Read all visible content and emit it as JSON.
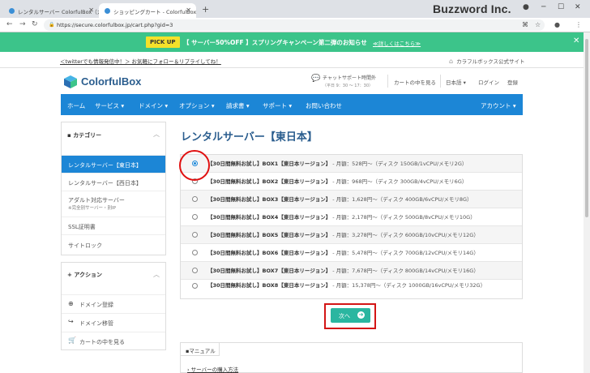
{
  "browser": {
    "tabs": [
      {
        "label": "レンタルサーバー ColorfulBox（カラフ"
      },
      {
        "label": "ショッピングカート - ColorfulBox"
      }
    ],
    "url": "https://secure.colorfulbox.jp/cart.php?gid=3",
    "brand": "Buzzword Inc."
  },
  "banner": {
    "pickup": "PICK UP",
    "text": "【 サーバー50%OFF 】スプリングキャンペーン第二弾のお知らせ",
    "link": "≪詳しくはこちら≫"
  },
  "infobar": {
    "twitter": "＜twitterでも情報発信中！＞ お気軽にフォロー＆リプライしてね！",
    "official": "カラフルボックス公式サイト"
  },
  "header": {
    "logo": "ColorfulBox",
    "chat_line1": "チャットサポート時間外",
    "chat_line2": "（平日 9：30 ～ 17：30）",
    "cart": "カートの中を見る",
    "lang": "日本語",
    "login": "ログイン",
    "register": "登録"
  },
  "menu": {
    "home": "ホーム",
    "service": "サービス",
    "domain": "ドメイン",
    "option": "オプション",
    "invoice": "請求書",
    "support": "サポート",
    "contact": "お問い合わせ",
    "account": "アカウント"
  },
  "sidebar": {
    "category_title": "カテゴリー",
    "items": [
      {
        "label": "レンタルサーバー【東日本】"
      },
      {
        "label": "レンタルサーバー【西日本】"
      },
      {
        "label": "アダルト対応サーバー",
        "sub": "※完全別サーバー・別IP"
      },
      {
        "label": "SSL証明書"
      },
      {
        "label": "サイトロック"
      }
    ],
    "action_title": "アクション",
    "actions": [
      {
        "label": "ドメイン登録"
      },
      {
        "label": "ドメイン移管"
      },
      {
        "label": "カートの中を見る"
      }
    ]
  },
  "main": {
    "title": "レンタルサーバー【東日本】",
    "options": [
      {
        "name": "【30日間無料お試し】BOX1【東日本リージョン】",
        "price": " - 月額：528円～（ディスク 150GB/1vCPU/メモリ2G）",
        "checked": true
      },
      {
        "name": "【30日間無料お試し】BOX2【東日本リージョン】",
        "price": " - 月額：968円～（ディスク 300GB/4vCPU/メモリ6G）",
        "checked": false
      },
      {
        "name": "【30日間無料お試し】BOX3【東日本リージョン】",
        "price": " - 月額：1,628円～（ディスク 400GB/6vCPU/メモリ8G）",
        "checked": false
      },
      {
        "name": "【30日間無料お試し】BOX4【東日本リージョン】",
        "price": " - 月額：2,178円～（ディスク 500GB/8vCPU/メモリ10G）",
        "checked": false
      },
      {
        "name": "【30日間無料お試し】BOX5【東日本リージョン】",
        "price": " - 月額：3,278円～（ディスク 600GB/10vCPU/メモリ12G）",
        "checked": false
      },
      {
        "name": "【30日間無料お試し】BOX6【東日本リージョン】",
        "price": " - 月額：5,478円～（ディスク 700GB/12vCPU/メモリ14G）",
        "checked": false
      },
      {
        "name": "【30日間無料お試し】BOX7【東日本リージョン】",
        "price": " - 月額：7,678円～（ディスク 800GB/14vCPU/メモリ16G）",
        "checked": false
      },
      {
        "name": "【30日間無料お試し】BOX8【東日本リージョン】",
        "price": " - 月額：15,378円～（ディスク 1000GB/16vCPU/メモリ32G）",
        "checked": false
      }
    ],
    "next": "次へ",
    "manual_tab": "マニュアル",
    "manual_link": "サーバーの購入方法"
  },
  "colors": {
    "accent": "#1c86d6",
    "banner": "#3cc48a",
    "button": "#2ab6a0",
    "highlight": "#e01010"
  }
}
